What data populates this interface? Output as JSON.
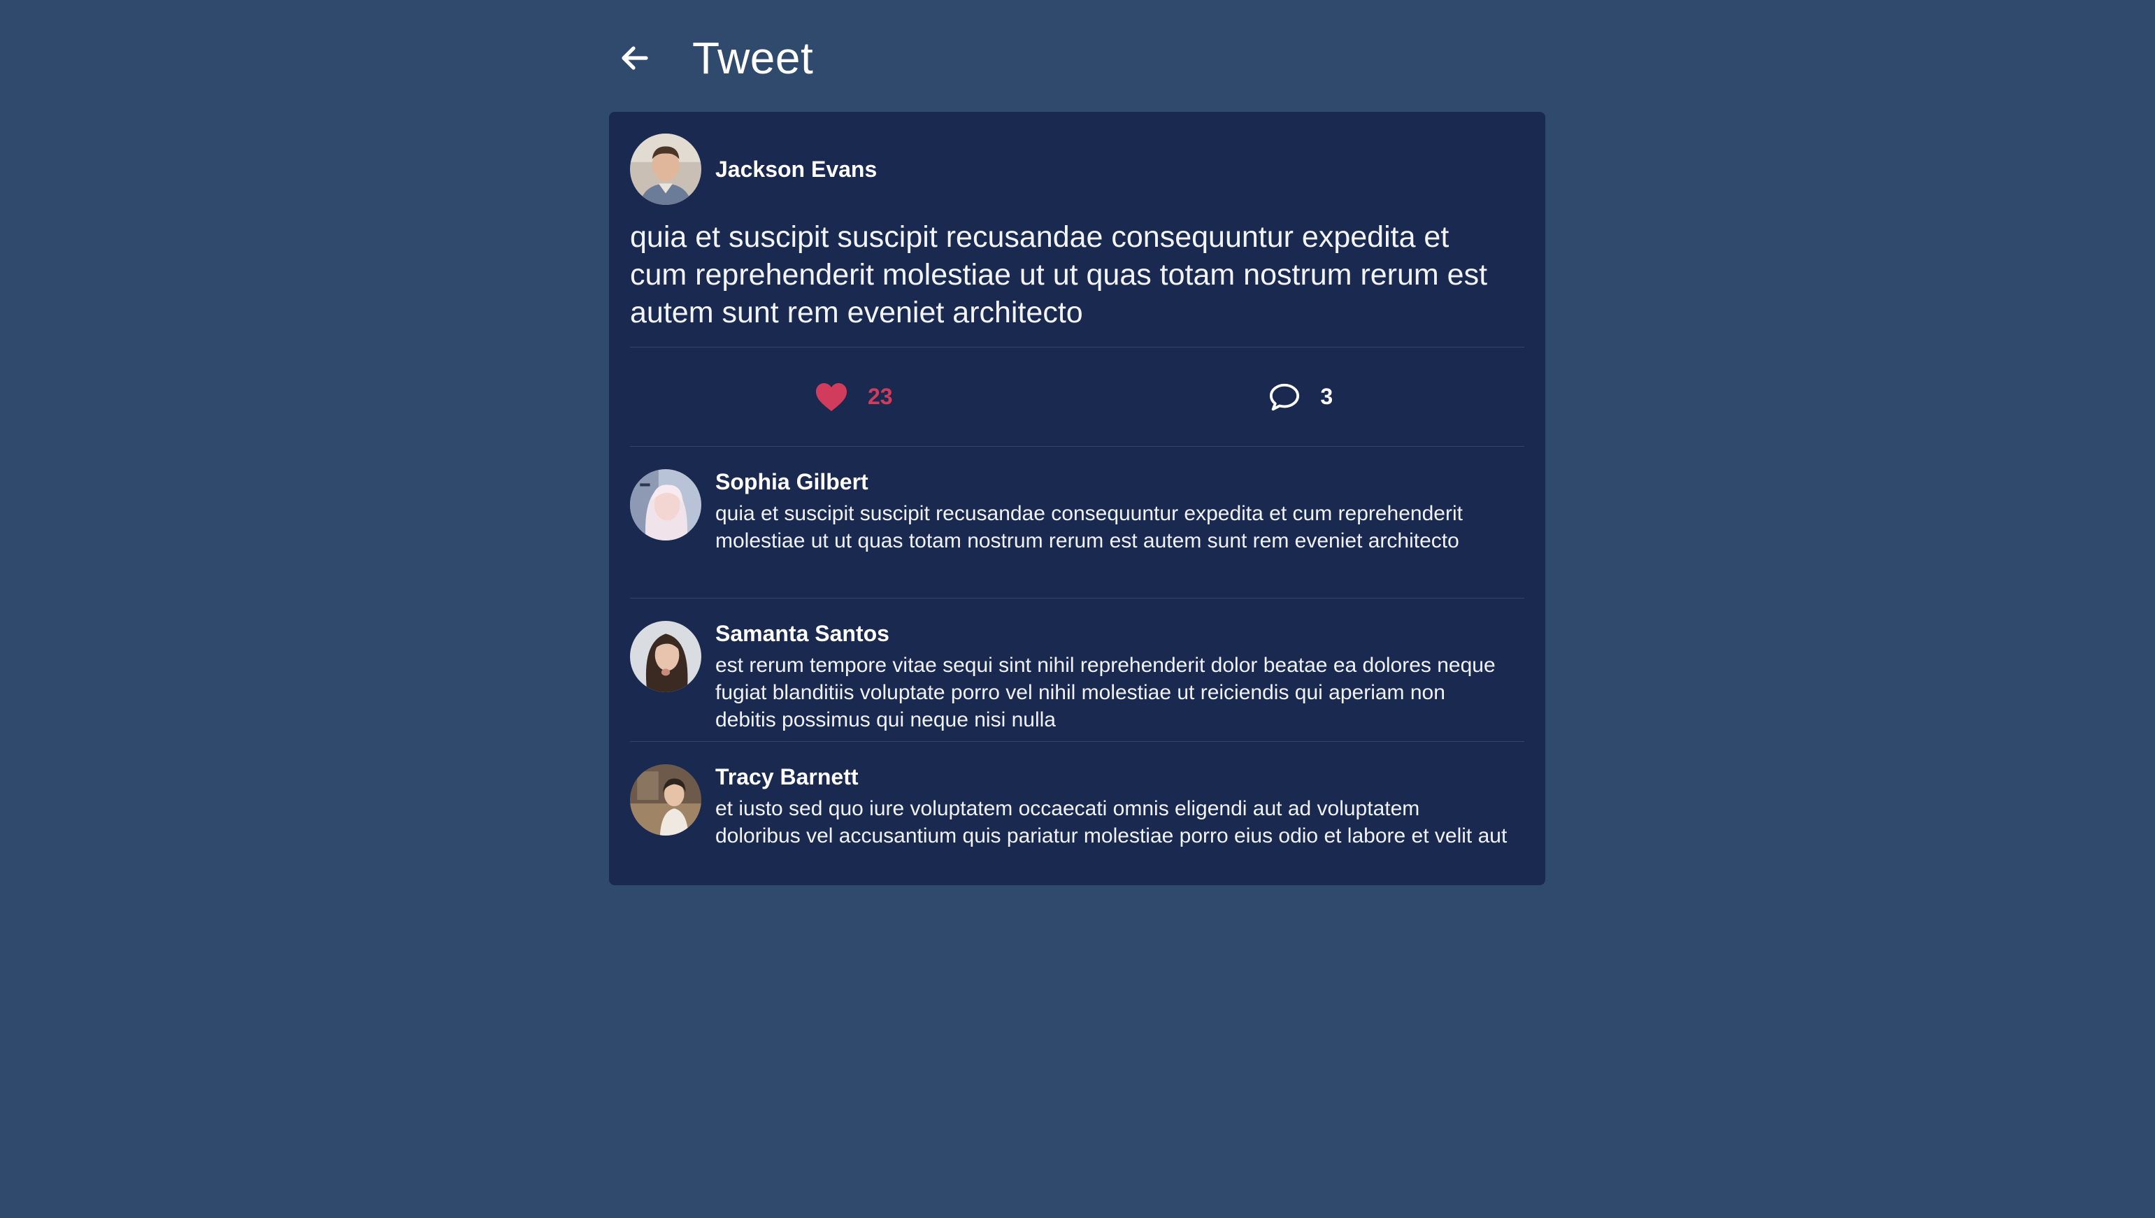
{
  "header": {
    "title": "Tweet",
    "back_icon": "arrow-left-icon"
  },
  "tweet": {
    "author": "Jackson Evans",
    "text": "quia et suscipit suscipit recusandae consequuntur expedita et cum reprehenderit molestiae ut ut quas totam nostrum rerum est autem sunt rem eveniet architecto",
    "likes": "23",
    "comments": "3",
    "like_icon": "heart-icon",
    "comment_icon": "speech-bubble-icon",
    "like_color": "#d23c5c"
  },
  "replies": [
    {
      "author": "Sophia Gilbert",
      "text": "quia et suscipit suscipit recusandae consequuntur expedita et cum reprehenderit molestiae ut ut quas totam nostrum rerum est autem sunt rem eveniet architecto"
    },
    {
      "author": "Samanta Santos",
      "text": "est rerum tempore vitae sequi sint nihil reprehenderit dolor beatae ea dolores neque fugiat blanditiis voluptate porro vel nihil molestiae ut reiciendis qui aperiam non debitis possimus qui neque nisi nulla"
    },
    {
      "author": "Tracy Barnett",
      "text": "et iusto sed quo iure voluptatem occaecati omnis eligendi aut ad voluptatem doloribus vel accusantium quis pariatur molestiae porro eius odio et labore et velit aut"
    }
  ],
  "colors": {
    "background": "#2f4a6c",
    "card": "#1a2950",
    "accent_like": "#d23c5c"
  }
}
